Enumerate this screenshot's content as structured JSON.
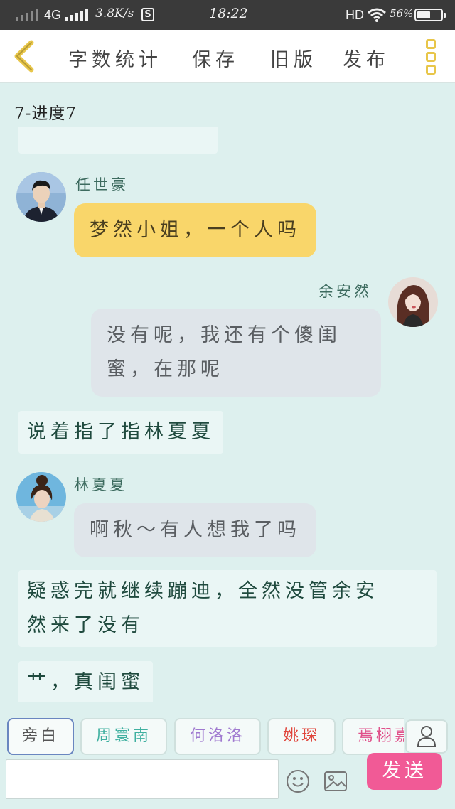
{
  "status_bar": {
    "network": "4G",
    "speed": "3.8K/s",
    "s_icon": "S",
    "time": "18:22",
    "hd": "HD",
    "battery_pct": "56%",
    "battery_level": 0.56
  },
  "toolbar": {
    "back_icon": "chevron-left-icon",
    "buttons": [
      "字数统计",
      "保存",
      "旧版",
      "发布"
    ],
    "more_icon": "three-square-menu-icon"
  },
  "chapter_title": "7-进度7",
  "messages": [
    {
      "type": "dialog",
      "side": "left",
      "speaker": "任世豪",
      "text": "梦然小姐，一个人吗",
      "bubble_color": "#f9d66a"
    },
    {
      "type": "dialog",
      "side": "right",
      "speaker": "余安然",
      "text": "没有呢，我还有个傻闺蜜，在那呢",
      "lines": [
        "没有呢，我还有个傻闺",
        "蜜，在那呢"
      ],
      "bubble_color": "#dfe5ea"
    },
    {
      "type": "narration",
      "text": "说着指了指林夏夏"
    },
    {
      "type": "dialog",
      "side": "left",
      "speaker": "林夏夏",
      "text": "啊秋～有人想我了吗",
      "bubble_color": "#dfe5ea"
    },
    {
      "type": "narration",
      "text": "疑惑完就继续蹦迪，全然没管余安然来了没有",
      "lines": [
        "疑惑完就继续蹦迪，全然没管余安",
        "然来了没有"
      ]
    },
    {
      "type": "narration",
      "text": "艹，真闺蜜"
    }
  ],
  "characters": [
    {
      "name": "旁白",
      "color": "#555555",
      "active": true
    },
    {
      "name": "周寰南",
      "color": "#3fb0a0",
      "active": false
    },
    {
      "name": "何洛洛",
      "color": "#a07ad0",
      "active": false
    },
    {
      "name": "姚琛",
      "color": "#e0443a",
      "active": false
    },
    {
      "name": "焉栩嘉",
      "color": "#e0508a",
      "active": false
    }
  ],
  "bottom": {
    "input_value": "",
    "input_placeholder": "",
    "send_label": "发送",
    "user_icon": "user-icon",
    "emoji_icon": "smiley-icon",
    "image_icon": "image-icon"
  },
  "colors": {
    "background": "#ddf0ee",
    "send_button": "#f15a96",
    "accent_yellow": "#e8c64a"
  }
}
